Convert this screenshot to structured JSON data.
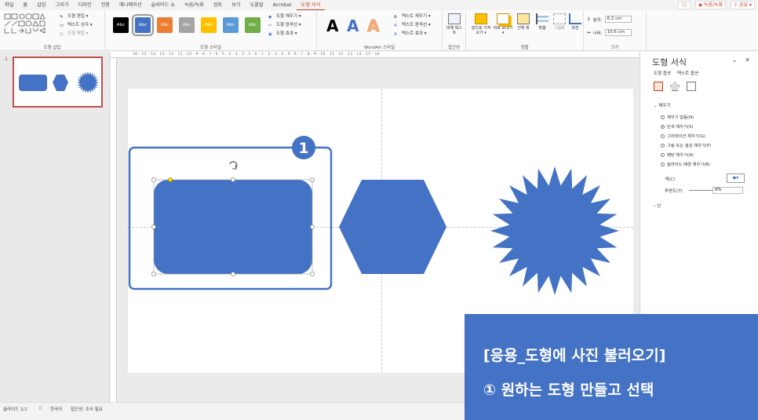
{
  "menu": {
    "tabs": [
      "파일",
      "홈",
      "삽입",
      "그리기",
      "디자인",
      "전환",
      "애니메이션",
      "슬라이드 쇼",
      "녹음/녹화",
      "검토",
      "보기",
      "도움말",
      "Acrobat",
      "도형 서식"
    ],
    "active_tab": "도형 서식",
    "right": {
      "comment": "🗨",
      "record": "◉ 녹음/녹화",
      "share": "⇪ 공유 ▾"
    }
  },
  "ribbon": {
    "insert_shapes": {
      "edit_shape": "도형 편집 ▾",
      "text_box": "텍스트 상자 ▾",
      "merge_shapes": "도형 병합 ▾",
      "label": "도형 삽입"
    },
    "shape_styles": {
      "swatches": [
        {
          "text": "Abc",
          "color": "#000000"
        },
        {
          "text": "Abc",
          "color": "#4472c4"
        },
        {
          "text": "Abc",
          "color": "#ed7d31"
        },
        {
          "text": "Abc",
          "color": "#a5a5a5"
        },
        {
          "text": "Abc",
          "color": "#ffc000"
        },
        {
          "text": "Abc",
          "color": "#5b9bd5"
        },
        {
          "text": "Abc",
          "color": "#70ad47"
        }
      ],
      "fill": "도형 채우기 ▾",
      "outline": "도형 윤곽선 ▾",
      "effects": "도형 효과 ▾",
      "label": "도형 스타일"
    },
    "wordart": {
      "letters": [
        {
          "ch": "A",
          "color": "#000000"
        },
        {
          "ch": "A",
          "color": "#4472c4"
        },
        {
          "ch": "A",
          "color": "#f4b183"
        }
      ],
      "text_fill": "텍스트 채우기 ▾",
      "text_outline": "텍스트 윤곽선 ▾",
      "text_effects": "텍스트 효과 ▾",
      "label": "WordArt 스타일"
    },
    "accessibility": {
      "alt_text": "대체 텍스트",
      "label": "접근성"
    },
    "arrange": {
      "bring_forward": "앞으로 가져오기 ▾",
      "send_backward": "뒤로 보내기 ▾",
      "selection_pane": "선택 창",
      "align": "맞춤",
      "group": "그룹화",
      "rotate": "회전",
      "label": "정렬"
    },
    "size": {
      "height_label": "높이:",
      "height_value": "6.2 cm",
      "width_label": "너비:",
      "width_value": "10.6 cm",
      "label": "크기"
    }
  },
  "slide_pane": {
    "slide_number": "1"
  },
  "ruler": {
    "ticks": "16 · 15 · 14 · 13 · 12 · 11 · 10 · 9 · 8 · 7 · 6 · 5 · 4 · 3 · 2 · 1 · 0 · 1 · 2 · 3 · 4 · 5 · 6 · 7 · 8 · 9 · 10 · 11 · 12 · 13 · 14 · 15 · 16"
  },
  "slide": {
    "callout_number": "1",
    "shape_color": "#4472c4",
    "highlight_color": "#4472c4"
  },
  "format_pane": {
    "title": "도형 서식",
    "tabs": [
      "도형 옵션",
      "텍스트 옵션"
    ],
    "fill_section": "채우기",
    "fill_options": [
      {
        "label": "채우기 없음(N)",
        "selected": false
      },
      {
        "label": "단색 채우기(S)",
        "selected": true
      },
      {
        "label": "그라데이션 채우기(G)",
        "selected": false
      },
      {
        "label": "그림 또는 질감 채우기(P)",
        "selected": false
      },
      {
        "label": "패턴 채우기(A)",
        "selected": false
      },
      {
        "label": "슬라이드 배경 채우기(B)",
        "selected": false
      }
    ],
    "color_label": "색(C)",
    "transparency_label": "투명도(T)",
    "transparency_value": "0%",
    "line_section": "선"
  },
  "status": {
    "slide_info": "슬라이드 1/1",
    "language": "한국어",
    "accessibility": "접근성: 조사 필요"
  },
  "caption": {
    "line1": "[응용_도형에 사진 불러오기]",
    "line2": "① 원하는 도형 만들고 선택"
  }
}
